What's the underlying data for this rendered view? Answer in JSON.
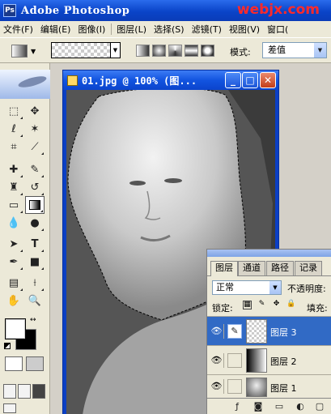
{
  "app": {
    "title": "Adobe Photoshop",
    "icon": "photoshop-icon",
    "watermark": "webjx.com"
  },
  "menu": [
    "文件(F)",
    "编辑(E)",
    "图像(I)",
    "图层(L)",
    "选择(S)",
    "滤镜(T)",
    "视图(V)",
    "窗口("
  ],
  "options": {
    "mode_label": "模式:",
    "mode_value": "差值"
  },
  "document": {
    "title": "01.jpg @ 100% (图..."
  },
  "layers_panel": {
    "tabs": [
      "图层",
      "通道",
      "路径",
      "记录"
    ],
    "blend_mode": "正常",
    "opacity_label": "不透明度:",
    "lock_label": "锁定:",
    "fill_label": "填充:",
    "layers": [
      {
        "name": "图层 3",
        "selected": true,
        "thumb": "transparent"
      },
      {
        "name": "图层 2",
        "selected": false,
        "thumb": "gradient"
      },
      {
        "name": "图层 1",
        "selected": false,
        "thumb": "photo"
      }
    ]
  },
  "colors": {
    "title_bar": "#0a44c8",
    "selection": "#316ac5",
    "watermark": "#ff2a2a",
    "foreground": "#ffffff",
    "background": "#000000"
  }
}
